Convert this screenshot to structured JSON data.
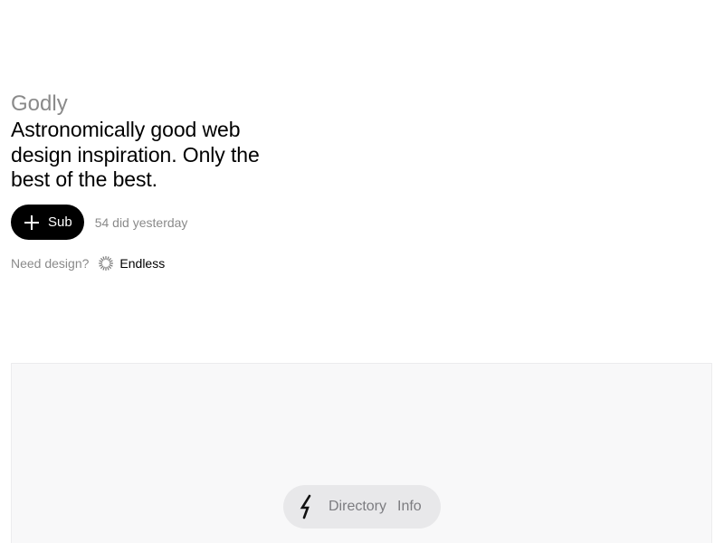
{
  "header": {
    "brand": "Godly",
    "tagline": "Astronomically good web design inspiration. Only the best of the best."
  },
  "subscribe": {
    "button_label": "Sub",
    "count_text": "54 did yesterday"
  },
  "promo": {
    "label": "Need design?",
    "link_label": "Endless",
    "link_icon": "sun-burst-icon"
  },
  "bottom_nav": {
    "logo_icon": "bolt-icon",
    "items": [
      {
        "label": "Directory"
      },
      {
        "label": "Info"
      }
    ]
  },
  "colors": {
    "background": "#ffffff",
    "muted_text": "#8a8a8a",
    "button_bg": "#000000",
    "panel_bg": "#f8f8f9",
    "nav_bg": "#e8e8ea"
  }
}
